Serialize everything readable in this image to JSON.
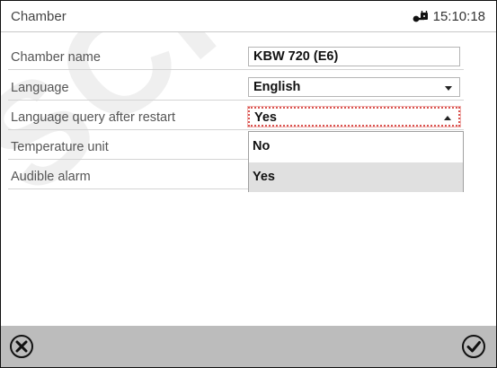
{
  "header": {
    "title": "Chamber",
    "time": "15:10:18"
  },
  "settings": [
    {
      "label": "Chamber name",
      "value": "KBW 720 (E6)",
      "kind": "text"
    },
    {
      "label": "Language",
      "value": "English",
      "kind": "select"
    },
    {
      "label": "Language query after restart",
      "value": "Yes",
      "kind": "select-open"
    },
    {
      "label": "Temperature unit"
    },
    {
      "label": "Audible alarm"
    }
  ],
  "dropdown": {
    "options": [
      "No",
      "Yes"
    ],
    "selected": "Yes"
  },
  "footer": {
    "cancel_icon": "close-circle-icon",
    "confirm_icon": "check-circle-icon"
  },
  "colors": {
    "footer": "#bcbcbc",
    "highlight_border": "#d9534f",
    "selected_option": "#e0e0e0"
  }
}
